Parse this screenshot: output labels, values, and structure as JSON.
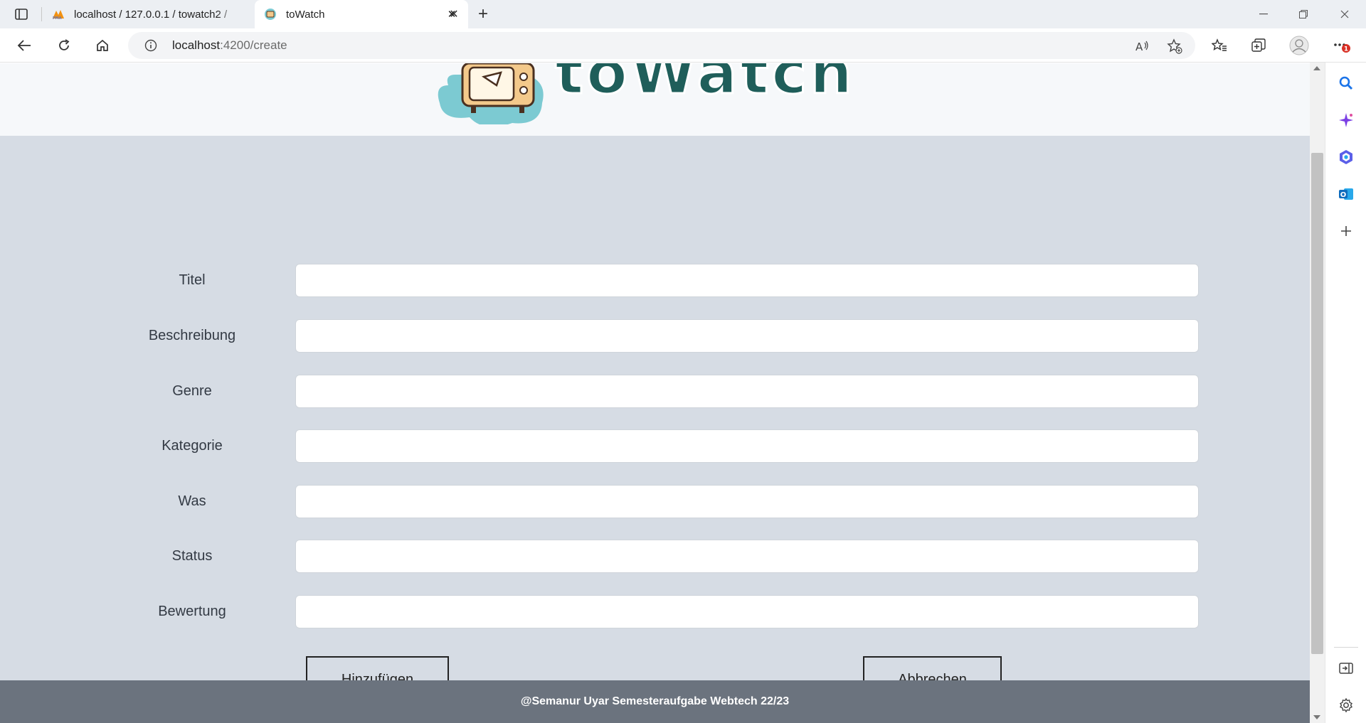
{
  "browser": {
    "tabs": [
      {
        "title": "localhost / 127.0.0.1 / towatch2 / ",
        "favicon": "phpmyadmin-icon"
      },
      {
        "title": "toWatch",
        "favicon": "towatch-tv-icon"
      }
    ],
    "url": {
      "host": "localhost",
      "path": ":4200/create"
    },
    "notification_badge": "1",
    "accent": "#1a73e8"
  },
  "header": {
    "logo_text": "toWatch",
    "colors": {
      "cloud": "#7ccad2",
      "tv": "#f3c98b",
      "text": "#1f5e5a"
    }
  },
  "form": {
    "fields": [
      {
        "label": "Titel",
        "value": ""
      },
      {
        "label": "Beschreibung",
        "value": ""
      },
      {
        "label": "Genre",
        "value": ""
      },
      {
        "label": "Kategorie",
        "value": ""
      },
      {
        "label": "Was",
        "value": ""
      },
      {
        "label": "Status",
        "value": ""
      },
      {
        "label": "Bewertung",
        "value": ""
      }
    ],
    "submit_label": "Hinzufügen",
    "cancel_label": "Abbrechen"
  },
  "footer": {
    "text": "@Semanur Uyar Semesteraufgabe Webtech 22/23"
  },
  "colors": {
    "page_bg": "#d6dce4",
    "header_bg": "#f6f8fa",
    "footer_bg": "#6b737e"
  }
}
